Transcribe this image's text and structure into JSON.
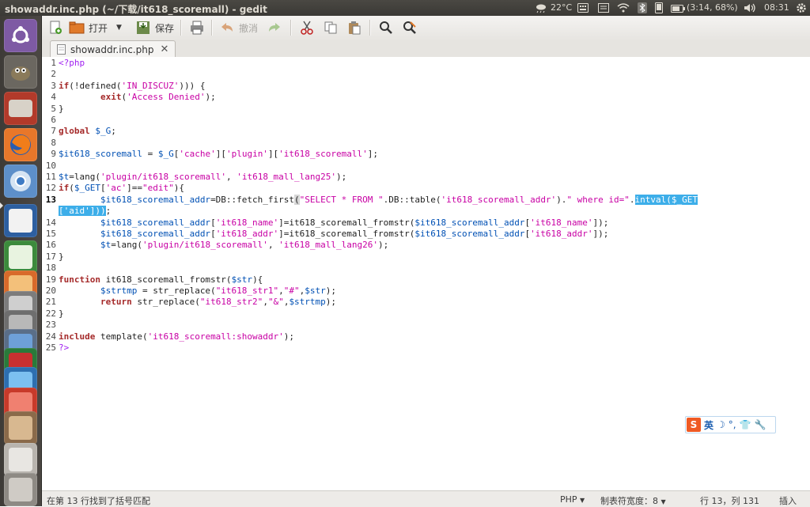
{
  "window": {
    "title": "showaddr.inc.php (~/下载/it618_scoremall) - gedit"
  },
  "indicators": {
    "weather": "22°C",
    "battery": "(3:14, 68%)",
    "clock": "08:31",
    "icons": [
      "weather-icon",
      "keyboard-icon",
      "mail-icon",
      "wifi-icon",
      "bluetooth-icon",
      "phone-icon",
      "battery-icon",
      "volume-icon",
      "gear-icon"
    ]
  },
  "launcher": {
    "items": [
      "ubuntu-dash",
      "gimp",
      "file-manager",
      "firefox",
      "chromium",
      "text-editor",
      "spreadsheet",
      "software-center",
      "screenshot",
      "disks",
      "ide",
      "youtube",
      "network",
      "app-red",
      "stacked-app",
      "layers-app"
    ]
  },
  "toolbar": {
    "open_label": "打开",
    "save_label": "保存",
    "undo_label": "撤消"
  },
  "tab": {
    "label": "showaddr.inc.php"
  },
  "editor": {
    "current_line": 13,
    "lines": [
      [
        [
          "ph",
          "<?php"
        ]
      ],
      [],
      [
        [
          "kw",
          "if"
        ],
        [
          "",
          "(!defined("
        ],
        [
          "str",
          "'IN_DISCUZ'"
        ],
        [
          "",
          "))) {"
        ]
      ],
      [
        [
          "",
          "        "
        ],
        [
          "kw",
          "exit"
        ],
        [
          "",
          "("
        ],
        [
          "str",
          "'Access Denied'"
        ],
        [
          "",
          ");"
        ]
      ],
      [
        [
          "",
          "}"
        ]
      ],
      [],
      [
        [
          "kw",
          "global"
        ],
        [
          "",
          " "
        ],
        [
          "var",
          "$_G"
        ],
        [
          "",
          ";"
        ]
      ],
      [],
      [
        [
          "var",
          "$it618_scoremall"
        ],
        [
          "",
          " = "
        ],
        [
          "var",
          "$_G"
        ],
        [
          "",
          "["
        ],
        [
          "str",
          "'cache'"
        ],
        [
          "",
          "]["
        ],
        [
          "str",
          "'plugin'"
        ],
        [
          "",
          "]["
        ],
        [
          "str",
          "'it618_scoremall'"
        ],
        [
          "",
          "];"
        ]
      ],
      [],
      [
        [
          "var",
          "$t"
        ],
        [
          "",
          "=lang("
        ],
        [
          "str",
          "'plugin/it618_scoremall'"
        ],
        [
          "",
          ", "
        ],
        [
          "str",
          "'it618_mall_lang25'"
        ],
        [
          "",
          ");"
        ]
      ],
      [
        [
          "kw",
          "if"
        ],
        [
          "",
          "("
        ],
        [
          "var",
          "$_GET"
        ],
        [
          "",
          "["
        ],
        [
          "str",
          "'ac'"
        ],
        [
          "",
          "]=="
        ],
        [
          "str",
          "\"edit\""
        ],
        [
          "",
          "){"
        ]
      ],
      [
        [
          "",
          "        "
        ],
        [
          "var",
          "$it618_scoremall_addr"
        ],
        [
          "",
          "=DB::fetch_first"
        ],
        [
          "bm",
          "("
        ],
        [
          "str",
          "\"SELECT * FROM \""
        ],
        [
          "",
          ".DB::table("
        ],
        [
          "str",
          "'it618_scoremall_addr'"
        ],
        [
          "",
          ")."
        ],
        [
          "str",
          "\" where id=\""
        ],
        [
          "",
          "."
        ],
        [
          "sel",
          "intval($_GET"
        ]
      ],
      [
        [
          "sel",
          "['aid']))"
        ],
        [
          "",
          ";"
        ]
      ],
      [
        [
          "",
          "        "
        ],
        [
          "var",
          "$it618_scoremall_addr"
        ],
        [
          "",
          "["
        ],
        [
          "str",
          "'it618_name'"
        ],
        [
          "",
          "]=it618_scoremall_fromstr("
        ],
        [
          "var",
          "$it618_scoremall_addr"
        ],
        [
          "",
          "["
        ],
        [
          "str",
          "'it618_name'"
        ],
        [
          "",
          "]);"
        ]
      ],
      [
        [
          "",
          "        "
        ],
        [
          "var",
          "$it618_scoremall_addr"
        ],
        [
          "",
          "["
        ],
        [
          "str",
          "'it618_addr'"
        ],
        [
          "",
          "]=it618_scoremall_fromstr("
        ],
        [
          "var",
          "$it618_scoremall_addr"
        ],
        [
          "",
          "["
        ],
        [
          "str",
          "'it618_addr'"
        ],
        [
          "",
          "]);"
        ]
      ],
      [
        [
          "",
          "        "
        ],
        [
          "var",
          "$t"
        ],
        [
          "",
          "=lang("
        ],
        [
          "str",
          "'plugin/it618_scoremall'"
        ],
        [
          "",
          ", "
        ],
        [
          "str",
          "'it618_mall_lang26'"
        ],
        [
          "",
          ");"
        ]
      ],
      [
        [
          "",
          "}"
        ]
      ],
      [],
      [
        [
          "kw",
          "function"
        ],
        [
          "",
          " it618_scoremall_fromstr("
        ],
        [
          "var",
          "$str"
        ],
        [
          "",
          "){"
        ]
      ],
      [
        [
          "",
          "        "
        ],
        [
          "var",
          "$strtmp"
        ],
        [
          "",
          " = str_replace("
        ],
        [
          "str",
          "\"it618_str1\""
        ],
        [
          "",
          ","
        ],
        [
          "str",
          "\"#\""
        ],
        [
          "",
          ","
        ],
        [
          "var",
          "$str"
        ],
        [
          "",
          ");"
        ]
      ],
      [
        [
          "",
          "        "
        ],
        [
          "kw",
          "return"
        ],
        [
          "",
          " str_replace("
        ],
        [
          "str",
          "\"it618_str2\""
        ],
        [
          "",
          ","
        ],
        [
          "str",
          "\"&\""
        ],
        [
          "",
          ","
        ],
        [
          "var",
          "$strtmp"
        ],
        [
          "",
          ");"
        ]
      ],
      [
        [
          "",
          "}"
        ]
      ],
      [],
      [
        [
          "kw",
          "include"
        ],
        [
          "",
          " template("
        ],
        [
          "str",
          "'it618_scoremall:showaddr'"
        ],
        [
          "",
          ");"
        ]
      ],
      [
        [
          "ph",
          "?>"
        ]
      ]
    ],
    "gutter": [
      "1",
      "2",
      "3",
      "4",
      "5",
      "6",
      "7",
      "8",
      "9",
      "10",
      "11",
      "12",
      "13",
      "",
      "14",
      "15",
      "16",
      "17",
      "18",
      "19",
      "20",
      "21",
      "22",
      "23",
      "24",
      "25"
    ]
  },
  "ime": {
    "label": "英"
  },
  "status": {
    "message": "在第 13 行找到了括号匹配",
    "language": "PHP",
    "tab_width": "制表符宽度：8",
    "position": "行 13，列 131",
    "mode": "插入"
  }
}
